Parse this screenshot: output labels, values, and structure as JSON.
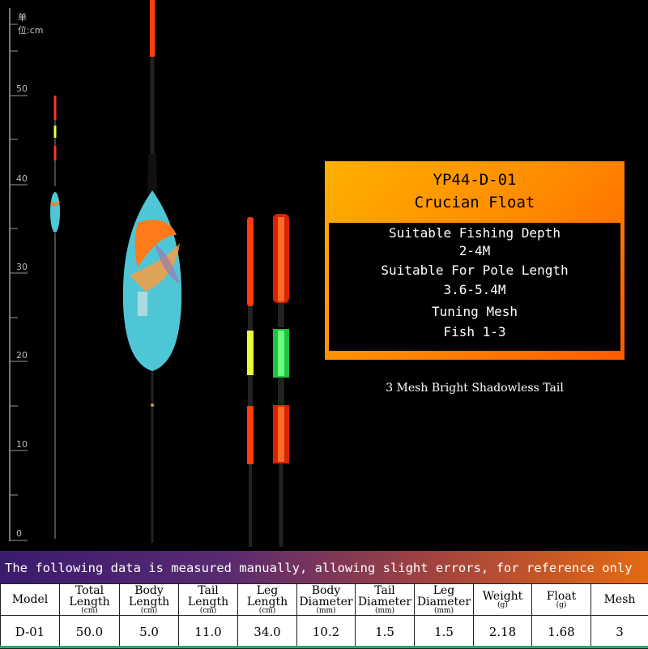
{
  "ruler": {
    "unit_label": "单位:cm",
    "marks": [
      "50",
      "40",
      "30",
      "20",
      "10",
      "0"
    ]
  },
  "promo": {
    "title_line1": "YP44-D-01",
    "title_line2": "Crucian Float",
    "lines": [
      "Suitable Fishing Depth",
      "2-4M",
      "Suitable For Pole Length",
      "3.6-5.4M",
      "Tuning Mesh",
      "Fish 1-3"
    ]
  },
  "caption": "3 Mesh Bright Shadowless Tail",
  "notice": "The following data is measured manually, allowing slight errors, for reference only",
  "float_label": "D-01",
  "table": {
    "headers": [
      {
        "label": "Model",
        "unit": ""
      },
      {
        "label": "Total Length",
        "unit": "(cm)"
      },
      {
        "label": "Body Length",
        "unit": "(cm)"
      },
      {
        "label": "Tail Length",
        "unit": "(cm)"
      },
      {
        "label": "Leg Length",
        "unit": "(cm)"
      },
      {
        "label": "Body Diameter",
        "unit": "(mm)"
      },
      {
        "label": "Tail Diameter",
        "unit": "(mm)"
      },
      {
        "label": "Leg Diameter",
        "unit": "(mm)"
      },
      {
        "label": "Weight",
        "unit": "(g)"
      },
      {
        "label": "Float",
        "unit": "(g)"
      },
      {
        "label": "Mesh",
        "unit": ""
      }
    ],
    "row": [
      "D-01",
      "50.0",
      "5.0",
      "11.0",
      "34.0",
      "10.2",
      "1.5",
      "1.5",
      "2.18",
      "1.68",
      "3"
    ]
  },
  "colors": {
    "promo_gradient_start": "#ffb000",
    "promo_gradient_end": "#ff5a00",
    "float_body": "#4fc6d6",
    "float_accent": "#ff7a1a",
    "tail_red": "#ff3a10",
    "tail_green": "#39ff5a",
    "tail_yellow": "#e8ff3a",
    "bottom_strip": "#1ab06b"
  }
}
